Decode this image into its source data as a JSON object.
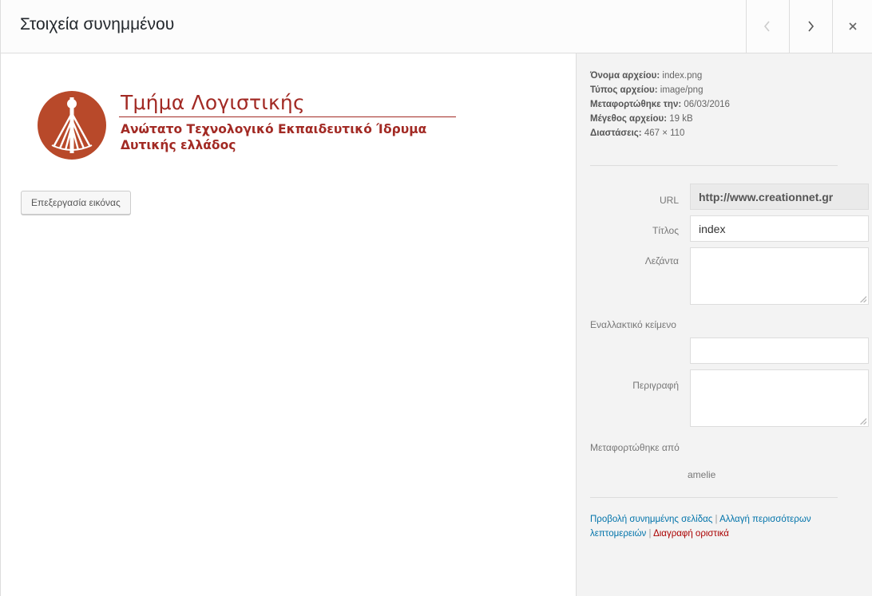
{
  "header": {
    "title": "Στοιχεία συνημμένου",
    "prev_icon": "chevron-left-icon",
    "next_icon": "chevron-right-icon",
    "close_icon": "close-icon"
  },
  "preview": {
    "logo": {
      "title": "Τμήμα Λογιστικής",
      "subtitle_line1": "Ανώτατο Τεχνολογικό Εκπαιδευτικό Ίδρυμα",
      "subtitle_line2": "Δυτικής ελλάδος",
      "color": "#a22a24"
    },
    "edit_button": "Επεξεργασία εικόνας"
  },
  "details": {
    "file_name_label": "Όνομα αρχείου:",
    "file_name": "index.png",
    "file_type_label": "Τύπος αρχείου:",
    "file_type": "image/png",
    "uploaded_on_label": "Μεταφορτώθηκε την:",
    "uploaded_on": "06/03/2016",
    "file_size_label": "Μέγεθος αρχείου:",
    "file_size": "19 kB",
    "dimensions_label": "Διαστάσεις:",
    "dimensions": "467 × 110"
  },
  "form": {
    "url_label": "URL",
    "url_value": "http://www.creationnet.gr",
    "title_label": "Τίτλος",
    "title_value": "index",
    "caption_label": "Λεζάντα",
    "caption_value": "",
    "alt_label": "Εναλλακτικό κείμενο",
    "alt_value": "",
    "description_label": "Περιγραφή",
    "description_value": "",
    "uploaded_by_label": "Μεταφορτώθηκε από",
    "uploaded_by": "amelie"
  },
  "actions": {
    "view_page": "Προβολή συνημμένης σελίδας",
    "separator": "|",
    "edit_more": "Αλλαγή περισσότερων λεπτομερειών",
    "delete": "Διαγραφή οριστικά",
    "link_color": "#0073aa",
    "delete_color": "#aa0000"
  }
}
